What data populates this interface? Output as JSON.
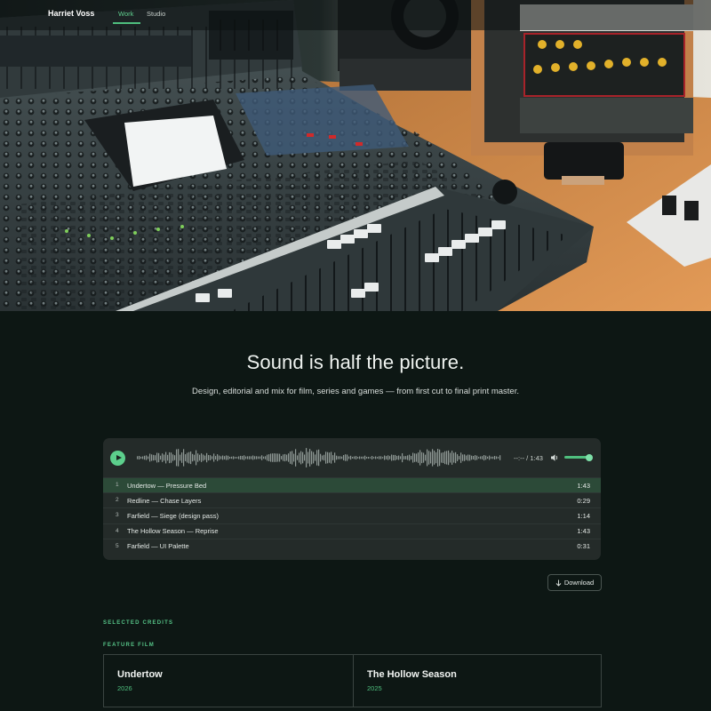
{
  "header": {
    "brand": "Harriet Voss",
    "nav": [
      {
        "label": "Work",
        "active": true
      },
      {
        "label": "Studio",
        "active": false
      }
    ]
  },
  "hero": {
    "headline": "Sound is half the picture.",
    "subline": "Design, editorial and mix for film, series and games — from first cut to final print master."
  },
  "player": {
    "time": "--:-- / 1:43",
    "play_icon": "play-icon",
    "volume_icon": "volume-icon",
    "volume_level": 0.85,
    "tracks": [
      {
        "num": "1",
        "title": "Undertow — Pressure Bed",
        "duration": "1:43",
        "active": true
      },
      {
        "num": "2",
        "title": "Redline — Chase Layers",
        "duration": "0:29",
        "active": false
      },
      {
        "num": "3",
        "title": "Farfield — Siege (design pass)",
        "duration": "1:14",
        "active": false
      },
      {
        "num": "4",
        "title": "The Hollow Season — Reprise",
        "duration": "1:43",
        "active": false
      },
      {
        "num": "5",
        "title": "Farfield — UI Palette",
        "duration": "0:31",
        "active": false
      }
    ]
  },
  "download": {
    "label": "Download",
    "icon": "arrow-down-icon"
  },
  "credits": {
    "section_label": "SELECTED CREDITS",
    "category_label": "FEATURE FILM",
    "items": [
      {
        "title": "Undertow",
        "year": "2026"
      },
      {
        "title": "The Hollow Season",
        "year": "2025"
      }
    ]
  },
  "colors": {
    "accent": "#4fbf7e",
    "background": "#0d1714",
    "panel": "#242b29",
    "active_row": "#2c4a38"
  }
}
